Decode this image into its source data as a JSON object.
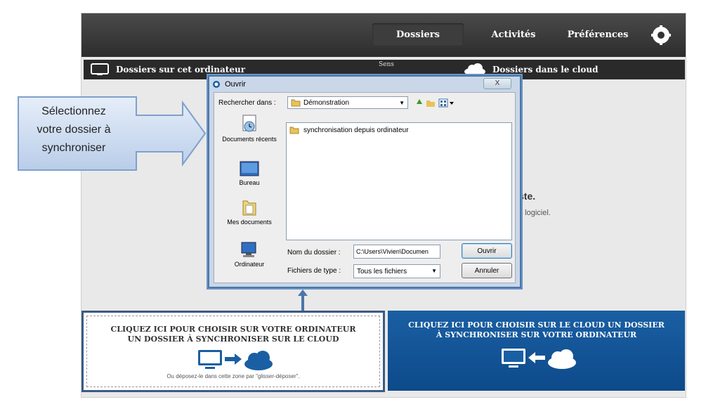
{
  "nav": {
    "dossiers": "Dossiers",
    "activites": "Activités",
    "preferences": "Préférences"
  },
  "subbar": {
    "local_label": "Dossiers sur cet ordinateur",
    "sens": "Sens",
    "cloud_label": "Dossiers dans le cloud"
  },
  "content": {
    "partial_title": "ste.",
    "partial_text": "e logiciel."
  },
  "callout": {
    "lines": [
      "Sélectionnez",
      "votre dossier à",
      "synchroniser"
    ]
  },
  "dialog": {
    "title": "Ouvrir",
    "close": "X",
    "search_label": "Rechercher dans :",
    "search_value": "Démonstration",
    "places": [
      "Documents récents",
      "Bureau",
      "Mes documents",
      "Ordinateur"
    ],
    "file_item": "synchronisation depuis ordinateur",
    "folder_name_label": "Nom du dossier :",
    "folder_name_value": "C:\\Users\\Vivien\\Documen",
    "file_type_label": "Fichiers de type :",
    "file_type_value": "Tous les fichiers",
    "open_button": "Ouvrir",
    "cancel_button": "Annuler"
  },
  "panels": {
    "local_line1": "CLIQUEZ ICI POUR CHOISIR SUR VOTRE ORDINATEUR",
    "local_line2": "UN DOSSIER À SYNCHRONISER SUR LE CLOUD",
    "local_hint": "Ou déposez-le dans cette zone par \"glisser-déposer\".",
    "cloud_line1": "CLIQUEZ ICI POUR CHOISIR SUR LE CLOUD UN DOSSIER",
    "cloud_line2": "À SYNCHRONISER SUR VOTRE ORDINATEUR"
  },
  "colors": {
    "accent_blue": "#0d4a8a",
    "dark_bar": "#2a2a2a"
  }
}
